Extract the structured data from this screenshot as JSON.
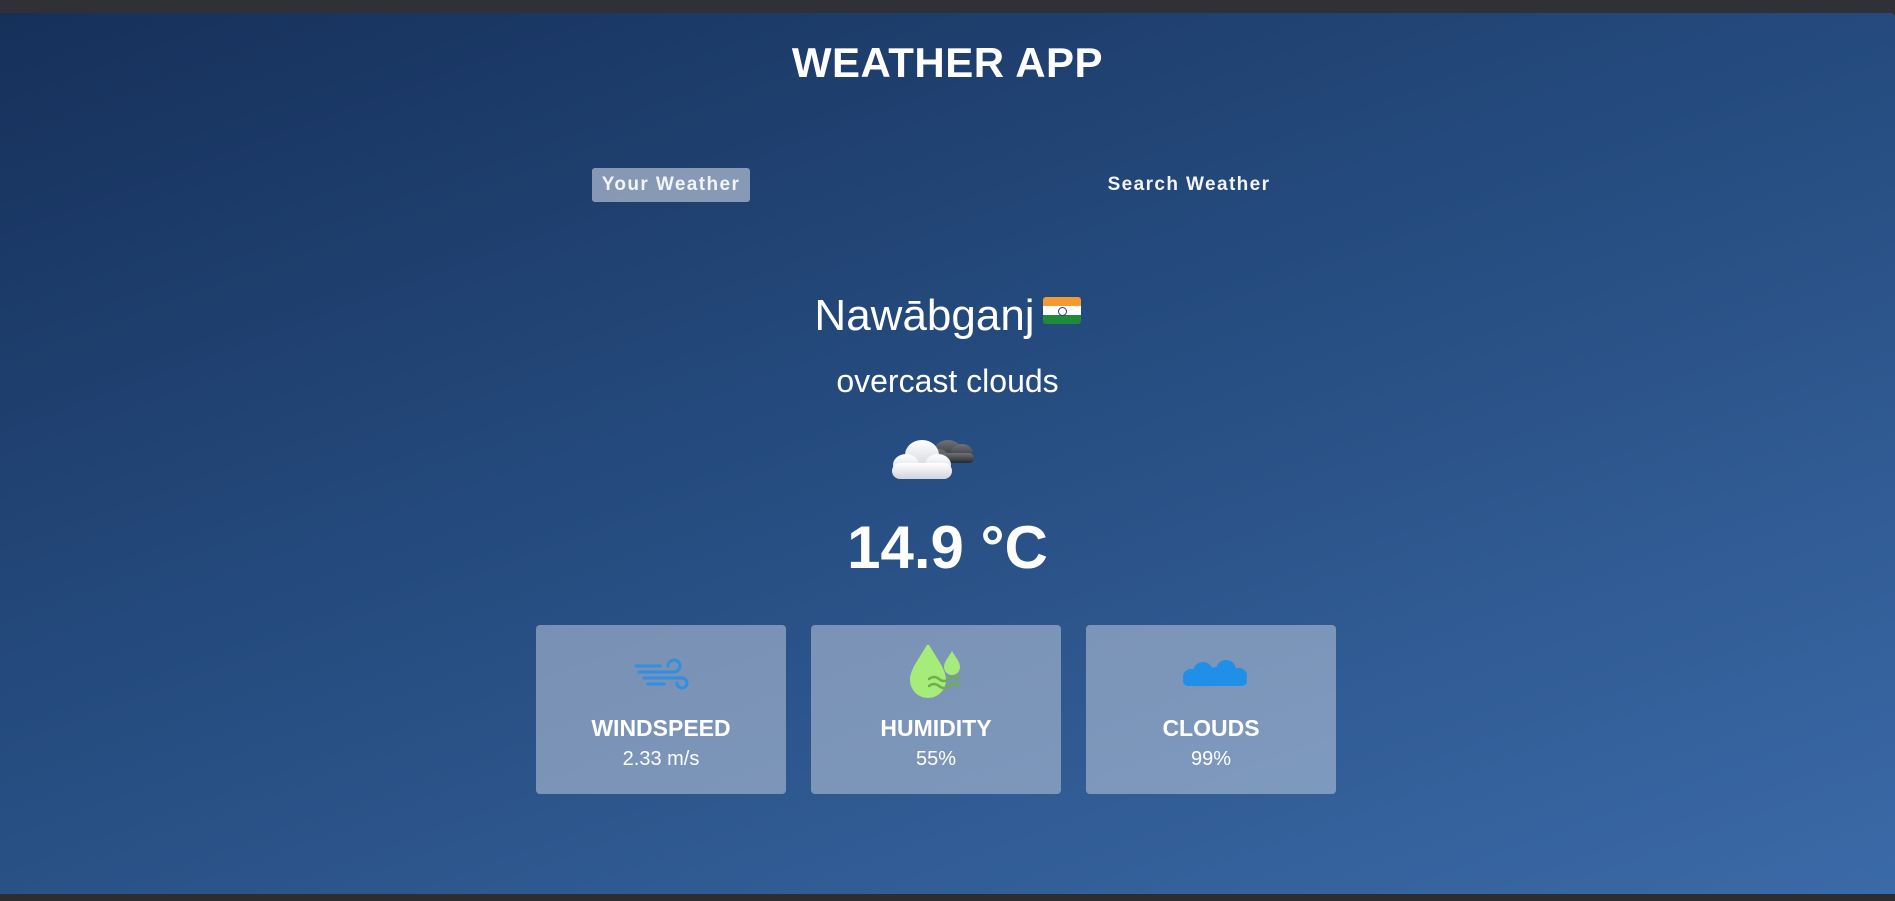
{
  "app": {
    "title": "WEATHER APP"
  },
  "tabs": [
    {
      "label": "Your Weather",
      "active": true
    },
    {
      "label": "Search Weather",
      "active": false
    }
  ],
  "weather": {
    "city": "Nawābganj",
    "country_flag": "india-flag-icon",
    "description": "overcast clouds",
    "condition_icon": "overcast-clouds-icon",
    "temperature": "14.9 °C"
  },
  "stats": [
    {
      "label": "WINDSPEED",
      "value": "2.33 m/s",
      "icon": "wind-icon",
      "color": "#2f8fe0"
    },
    {
      "label": "HUMIDITY",
      "value": "55%",
      "icon": "humidity-drop-icon",
      "color": "#a6ec7a"
    },
    {
      "label": "CLOUDS",
      "value": "99%",
      "icon": "cloud-icon",
      "color": "#1f8fe8"
    }
  ],
  "colors": {
    "background_top": "#16305a",
    "background_bottom": "#3b6aa8",
    "card_background": "#c8d2e4",
    "text": "#ffffff"
  }
}
